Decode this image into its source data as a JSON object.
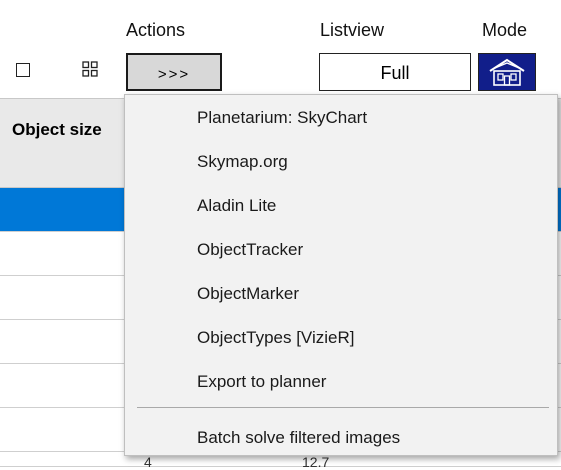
{
  "toolbar": {
    "actions_label": "Actions",
    "listview_label": "Listview",
    "mode_label": "Mode",
    "actions_button_label": ">>>",
    "listview_value": "Full",
    "select_checkbox_icon": "checkbox-icon",
    "grid_icon": "grid-view-icon",
    "mode_icon": "house-icon"
  },
  "table": {
    "header_label": "Object size",
    "selected_color": "#0078d7",
    "partial_cells": [
      "4",
      "12.7"
    ]
  },
  "menu": {
    "items": [
      "Planetarium: SkyChart",
      "Skymap.org",
      "Aladin Lite",
      "ObjectTracker",
      "ObjectMarker",
      "ObjectTypes [VizieR]",
      "Export to planner"
    ],
    "footer_item": "Batch solve filtered images"
  },
  "colors": {
    "mode_button_bg": "#111e8a",
    "menu_bg": "#f2f2f2"
  }
}
